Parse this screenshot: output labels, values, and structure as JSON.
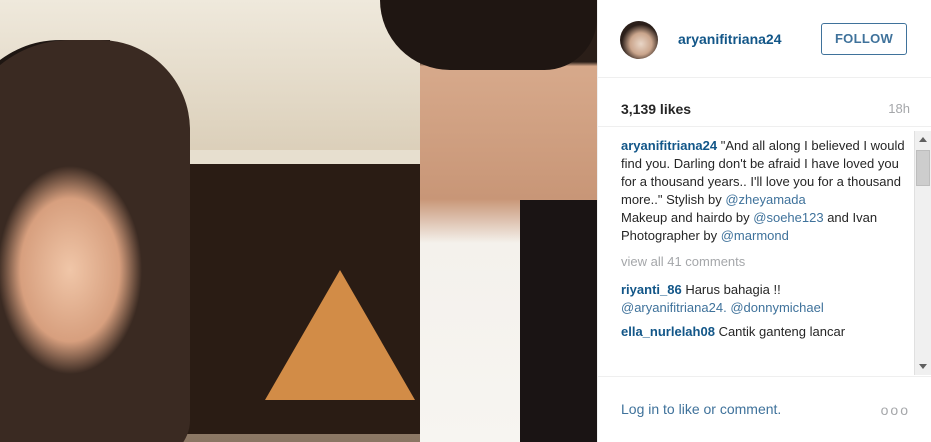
{
  "post": {
    "username": "aryanifitriana24",
    "follow_label": "FOLLOW",
    "likes": "3,139 likes",
    "time_ago": "18h"
  },
  "caption": {
    "username": "aryanifitriana24",
    "text_1": "\"And all along I believed I would find you. Darling don't be afraid I have loved you for a thousand years.. I'll love you for a thousand more..\" Stylish by ",
    "mention_1": "@zheyamada",
    "text_2": "Makeup and hairdo by ",
    "mention_2": "@soehe123",
    "text_3": " and Ivan",
    "text_4": "Photographer by ",
    "mention_3": "@marmond"
  },
  "view_all": "view all 41 comments",
  "comments": [
    {
      "username": "riyanti_86",
      "text": " Harus bahagia !! ",
      "mention_1": "@aryanifitriana24.",
      "mention_2": "@donnymichael"
    },
    {
      "username": "ella_nurlelah08",
      "text": " Cantik ganteng lancar"
    }
  ],
  "footer": {
    "login_text": "Log in to like or comment.",
    "more_glyph": "ooo"
  },
  "icons": [
    "avatar",
    "scroll-up-arrow-icon",
    "scroll-down-arrow-icon",
    "more-options-icon"
  ]
}
